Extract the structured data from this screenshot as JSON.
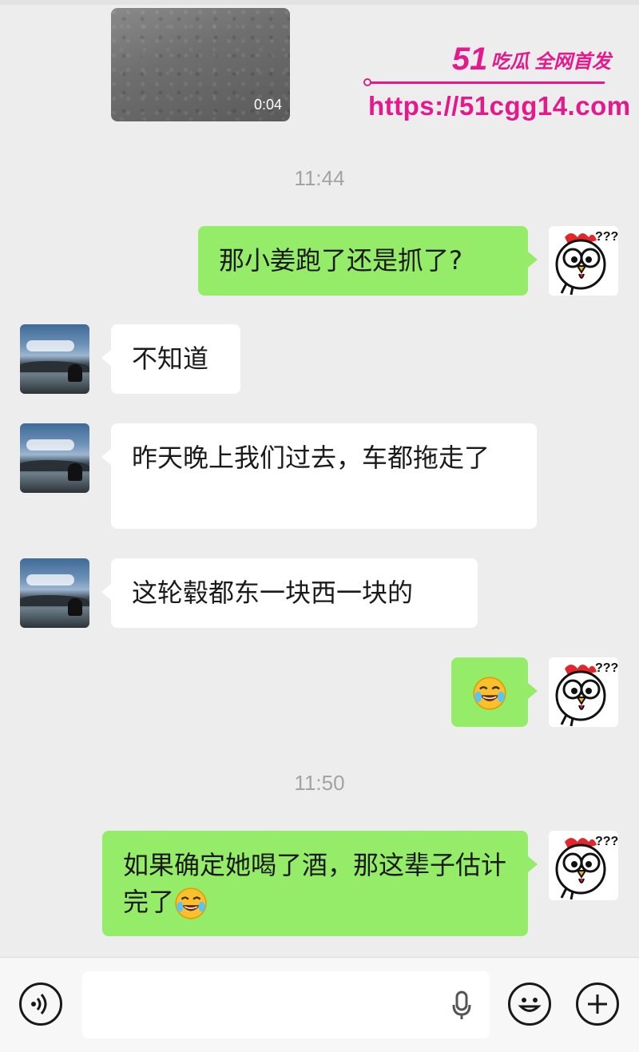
{
  "video_message": {
    "duration": "0:04"
  },
  "watermark": {
    "number": "51",
    "tagline": "吃瓜 全网首发",
    "url": "https://51cgg14.com"
  },
  "timestamps": [
    "11:44",
    "11:50"
  ],
  "messages": [
    {
      "sender": "self",
      "text": "那小姜跑了还是抓了?"
    },
    {
      "sender": "contact",
      "text": "不知道"
    },
    {
      "sender": "contact",
      "text": "昨天晚上我们过去，车都拖走了"
    },
    {
      "sender": "contact",
      "text": "这轮毂都东一块西一块的"
    },
    {
      "sender": "self",
      "text": "",
      "emoji": "face-with-tears-of-joy"
    },
    {
      "sender": "self",
      "text": "如果确定她喝了酒，那这辈子估计完了",
      "emoji": "face-with-tears-of-joy"
    }
  ],
  "avatar_icons": {
    "contact": "landscape-silhouette-avatar",
    "self": "confused-chicken-avatar"
  },
  "input_bar": {
    "icons": [
      "voice-icon",
      "microphone-icon",
      "emoji-icon",
      "plus-icon"
    ]
  },
  "colors": {
    "background": "#ededed",
    "outgoing_bubble": "#95ec69",
    "incoming_bubble": "#ffffff",
    "watermark": "#e5198b",
    "timestamp": "#a3a3a3"
  }
}
